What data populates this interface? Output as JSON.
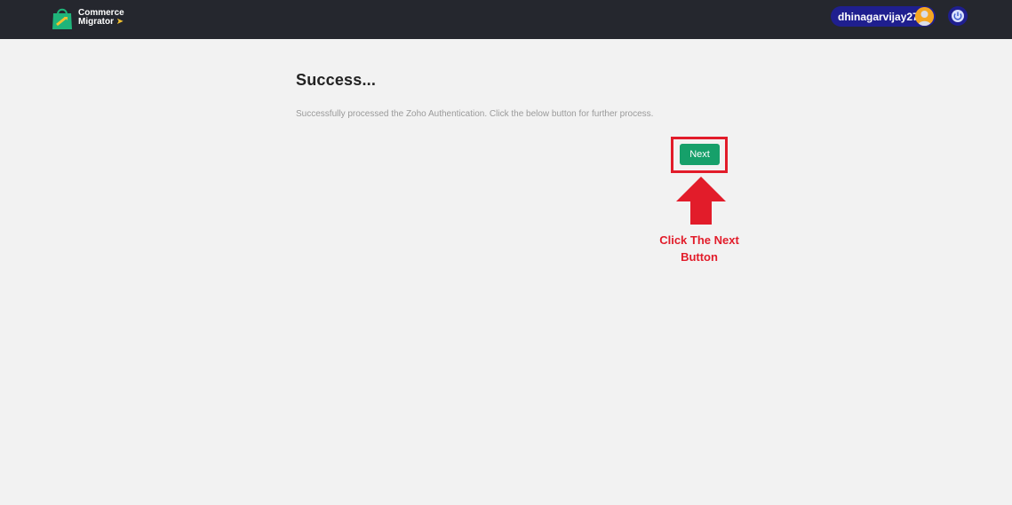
{
  "header": {
    "brand_line1": "Commerce",
    "brand_line2": "Migrator",
    "user": {
      "name": "dhinagarvijay27",
      "avatar_icon": "user-avatar-icon"
    },
    "power_icon": "power-icon"
  },
  "main": {
    "title": "Success...",
    "message": "Successfully processed the Zoho Authentication. Click the below button for further process.",
    "next_label": "Next"
  },
  "annotation": {
    "line1": "Click The Next",
    "line2": "Button"
  },
  "colors": {
    "topbar": "#25272e",
    "user_chip": "#1f1f8f",
    "next_button": "#16a06a",
    "annotation_red": "#e21c2a",
    "page_bg": "#f2f2f2"
  }
}
